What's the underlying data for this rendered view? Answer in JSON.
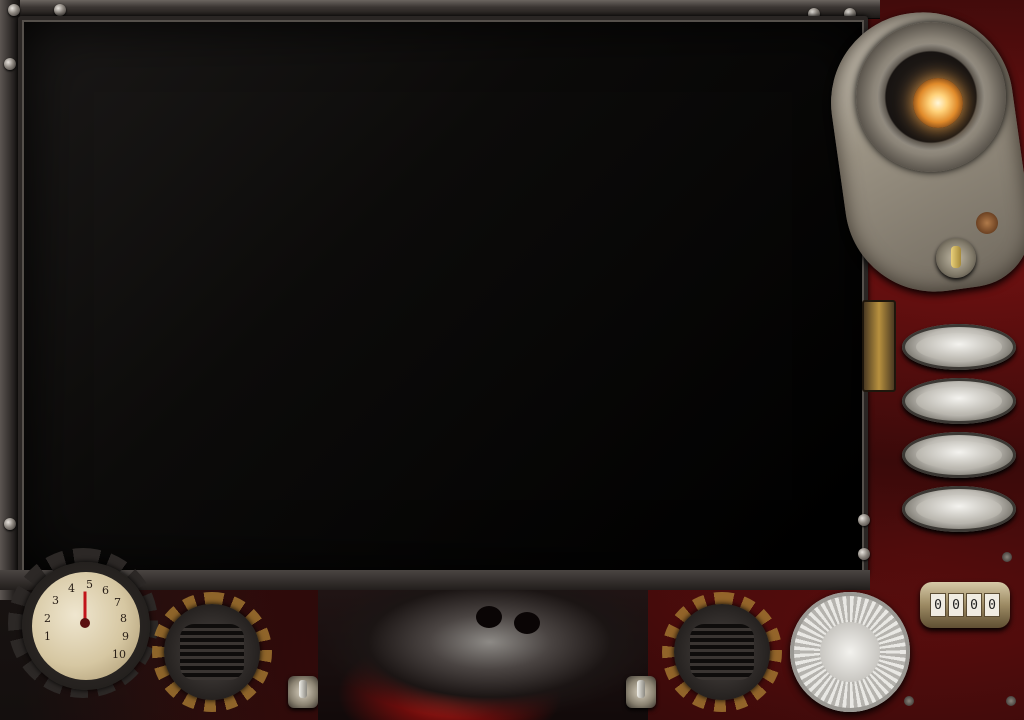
{
  "screen": {
    "content": ""
  },
  "gauge": {
    "numbers": [
      "1",
      "2",
      "3",
      "4",
      "5",
      "6",
      "7",
      "8",
      "9",
      "10"
    ],
    "needle_value": 4
  },
  "counter": {
    "digits": [
      "0",
      "0",
      "0",
      "0"
    ]
  },
  "side_buttons": [
    "",
    "",
    "",
    ""
  ],
  "colors": {
    "lamp_glow": "#f3a547",
    "gauge_needle": "#c1141a",
    "frame_red": "#7a1212"
  }
}
